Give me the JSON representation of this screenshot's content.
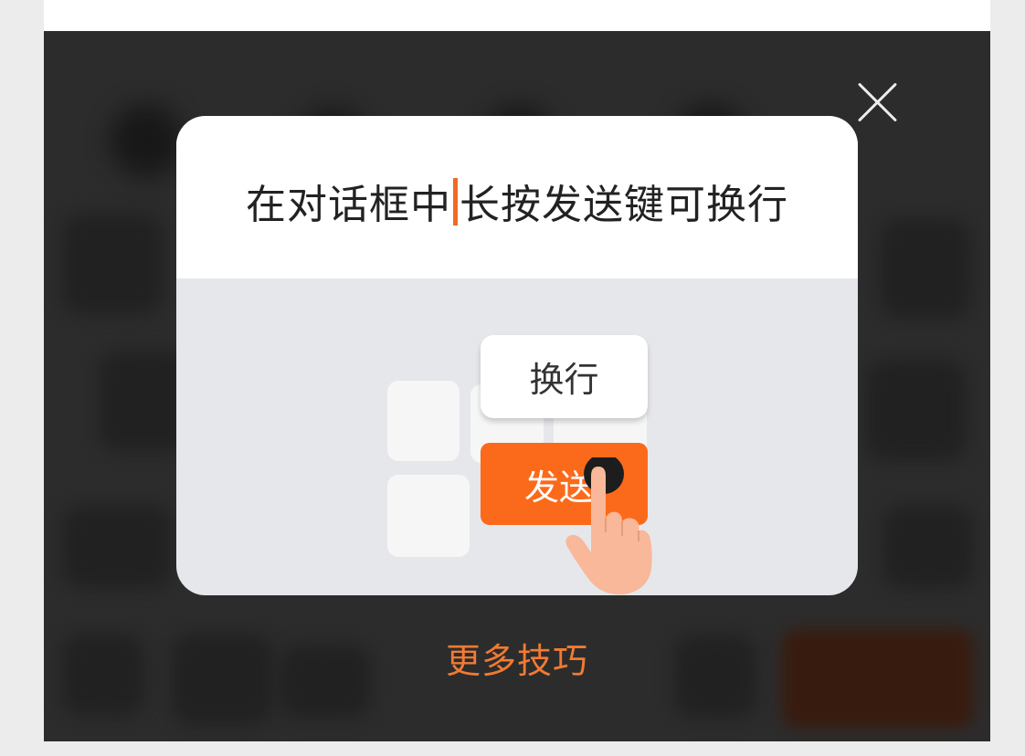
{
  "dialog": {
    "tip_before": "在对话框中",
    "tip_after": "长按发送键可换行",
    "popup_label": "换行",
    "send_label": "发送"
  },
  "footer": {
    "more_tips": "更多技巧"
  },
  "icons": {
    "close": "close-icon",
    "hand": "hand-pointer-icon"
  },
  "colors": {
    "accent": "#fb6a1a",
    "link": "#f27a33",
    "overlay": "#2c2c2c",
    "dialog_body": "#e6e7eb"
  }
}
